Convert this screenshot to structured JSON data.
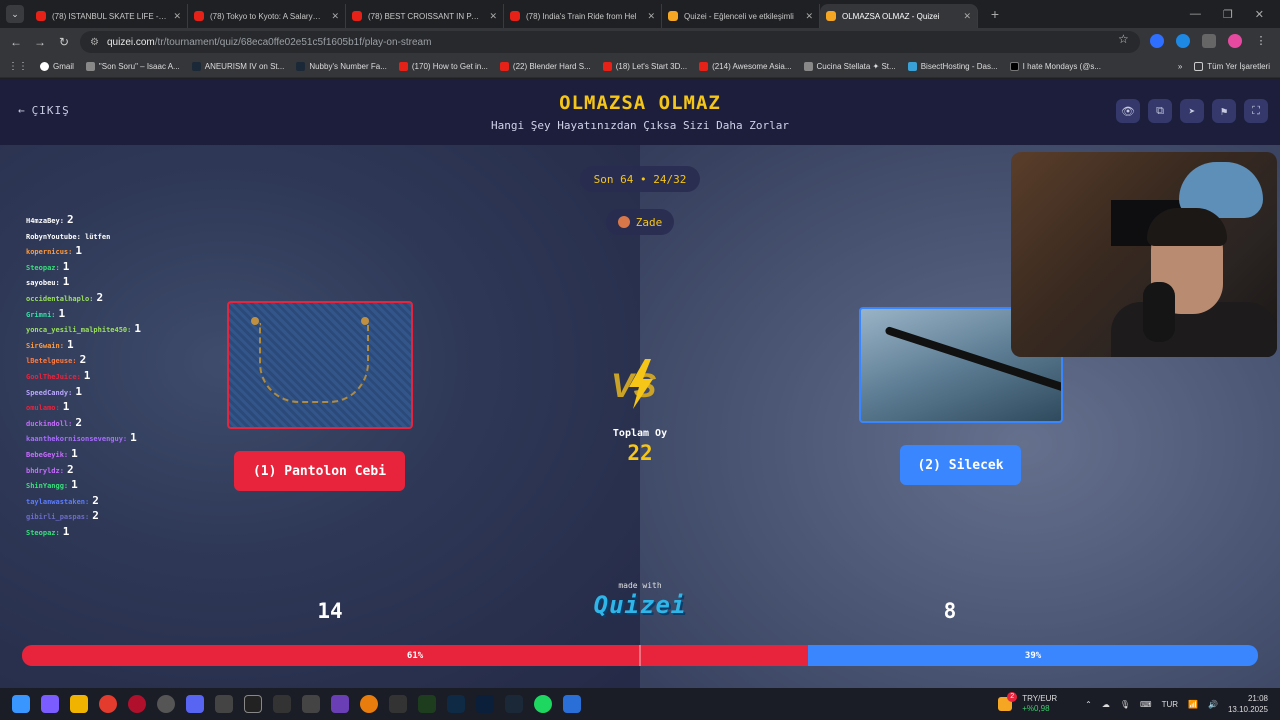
{
  "browser": {
    "tabs": [
      {
        "title": "(78) ISTANBUL SKATE LIFE - You",
        "icon": "youtube-icon",
        "active": false
      },
      {
        "title": "(78) Tokyo to Kyoto: A Salaryman",
        "icon": "youtube-icon",
        "active": false
      },
      {
        "title": "(78) BEST CROISSANT IN PARIS",
        "icon": "youtube-icon",
        "active": false
      },
      {
        "title": "(78) India's Train Ride from Hel",
        "icon": "youtube-icon",
        "active": false
      },
      {
        "title": "Quizei - Eğlenceli ve etkileşimli",
        "icon": "quizei-icon",
        "active": false
      },
      {
        "title": "OLMAZSA OLMAZ - Quizei",
        "icon": "quizei-icon",
        "active": true
      }
    ],
    "url_host": "quizei.com",
    "url_path": "/tr/tournament/quiz/68eca0ffe02e51c5f1605b1f/play-on-stream",
    "bookmarks": [
      {
        "label": "Gmail",
        "icon": "google-icon"
      },
      {
        "label": "\"Son Soru\" – Isaac A...",
        "icon": "bookmark-icon"
      },
      {
        "label": "ANEURISM IV on St...",
        "icon": "steam-icon"
      },
      {
        "label": "Nubby's Number Fa...",
        "icon": "steam-icon"
      },
      {
        "label": "(170) How to Get in...",
        "icon": "youtube-icon"
      },
      {
        "label": "(22) Blender Hard S...",
        "icon": "youtube-icon"
      },
      {
        "label": "(18) Let's Start 3D...",
        "icon": "youtube-icon"
      },
      {
        "label": "(214) Awesome Asia...",
        "icon": "youtube-icon"
      },
      {
        "label": "Cucina Stellata ✦ St...",
        "icon": "bookmark-icon"
      },
      {
        "label": "BisectHosting - Das...",
        "icon": "bookmark-icon"
      },
      {
        "label": "I hate Mondays (@s...",
        "icon": "x-icon"
      }
    ],
    "bookmarks_more": "»",
    "all_bookmarks": "Tüm Yer İşaretleri"
  },
  "header": {
    "exit_label": "ÇIKIŞ",
    "title": "OLMAZSA OLMAZ",
    "subtitle": "Hangi Şey Hayatınızdan Çıksa Sizi Daha Zorlar"
  },
  "match": {
    "round": "Son 64 • 24/32",
    "user": "Zade",
    "left_option": "(1) Pantolon Cebi",
    "right_option": "(2) Silecek",
    "total_label": "Toplam Oy",
    "total_votes": "22",
    "left_votes": "14",
    "right_votes": "8",
    "left_percent_label": "61%",
    "right_percent_label": "39%",
    "left_fraction": 0.636,
    "colors": {
      "left": "#e8243c",
      "right": "#3a86ff",
      "accent": "#f5c518"
    }
  },
  "branding": {
    "made_with": "made with",
    "name": "Quizei"
  },
  "chat": [
    {
      "user": "H4mzaBey:",
      "count": "2",
      "color": "#ffffff"
    },
    {
      "user": "RobynYoutube: lütfen",
      "count": "",
      "color": "#ffffff"
    },
    {
      "user": "kopernicus:",
      "count": "1",
      "color": "#ff9a3c"
    },
    {
      "user": "Steopaz:",
      "count": "1",
      "color": "#38e07b"
    },
    {
      "user": "sayobeu:",
      "count": "1",
      "color": "#ffffff"
    },
    {
      "user": "occidentalhaplo:",
      "count": "2",
      "color": "#9be15d"
    },
    {
      "user": "Grimni:",
      "count": "1",
      "color": "#38e0a8"
    },
    {
      "user": "yonca_yesili_malphite450:",
      "count": "1",
      "color": "#9be15d"
    },
    {
      "user": "SirGwain:",
      "count": "1",
      "color": "#ff9a3c"
    },
    {
      "user": "lBetelgeuse:",
      "count": "2",
      "color": "#ff7a3c"
    },
    {
      "user": "GoolTheJuice:",
      "count": "1",
      "color": "#e8243c"
    },
    {
      "user": "SpeedCandy:",
      "count": "1",
      "color": "#b9a7ff"
    },
    {
      "user": "omulamo:",
      "count": "1",
      "color": "#e8243c"
    },
    {
      "user": "duckindoll:",
      "count": "2",
      "color": "#c86cff"
    },
    {
      "user": "kaanthekornisonsevenguy:",
      "count": "1",
      "color": "#a86cff"
    },
    {
      "user": "BebeGeyik:",
      "count": "1",
      "color": "#c86cff"
    },
    {
      "user": "bhdryldz:",
      "count": "2",
      "color": "#c86cff"
    },
    {
      "user": "ShinYangg:",
      "count": "1",
      "color": "#38e07b"
    },
    {
      "user": "taylanwastaken:",
      "count": "2",
      "color": "#5c7cff"
    },
    {
      "user": "gibirli_paspas:",
      "count": "2",
      "color": "#6c6cc8"
    },
    {
      "user": "Steopaz:",
      "count": "1",
      "color": "#38e07b"
    }
  ],
  "taskbar": {
    "currency_pair": "TRY/EUR",
    "currency_change": "+%0,98",
    "currency_badge": "2",
    "lang": "TUR",
    "time": "21:08",
    "date": "13.10.2025"
  }
}
